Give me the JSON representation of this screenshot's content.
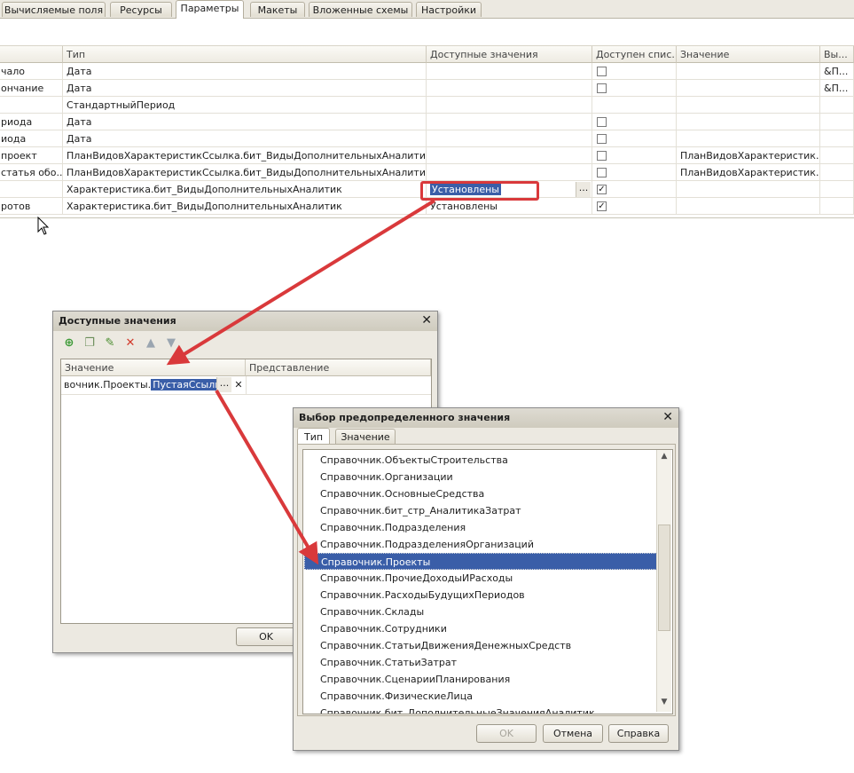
{
  "tabs": [
    {
      "label": "Вычисляемые поля",
      "active": false
    },
    {
      "label": "Ресурсы",
      "active": false
    },
    {
      "label": "Параметры",
      "active": true
    },
    {
      "label": "Макеты",
      "active": false
    },
    {
      "label": "Вложенные схемы",
      "active": false
    },
    {
      "label": "Настройки",
      "active": false
    }
  ],
  "grid": {
    "headers": [
      "",
      "Тип",
      "Доступные значения",
      "Доступен спис...",
      "Значение",
      "Вы..."
    ],
    "rows": [
      {
        "name": "чало",
        "type": "Дата",
        "avail": "",
        "check": "off",
        "value": "",
        "extra": "&П..."
      },
      {
        "name": "ончание",
        "type": "Дата",
        "avail": "",
        "check": "off",
        "value": "",
        "extra": "&П..."
      },
      {
        "name": "",
        "type": "СтандартныйПериод",
        "avail": "",
        "check": "none",
        "value": "",
        "extra": ""
      },
      {
        "name": "риода",
        "type": "Дата",
        "avail": "",
        "check": "off",
        "value": "",
        "extra": ""
      },
      {
        "name": "иода",
        "type": "Дата",
        "avail": "",
        "check": "off",
        "value": "",
        "extra": ""
      },
      {
        "name": "проект",
        "type": "ПланВидовХарактеристикСсылка.бит_ВидыДополнительныхАналитик",
        "avail": "",
        "check": "off",
        "value": "ПланВидовХарактеристик.б...",
        "extra": ""
      },
      {
        "name": "статья обо...",
        "type": "ПланВидовХарактеристикСсылка.бит_ВидыДополнительныхАналитик",
        "avail": "",
        "check": "off",
        "value": "ПланВидовХарактеристик.б...",
        "extra": ""
      },
      {
        "name": "",
        "type": "Характеристика.бит_ВидыДополнительныхАналитик",
        "avail": "Установлены",
        "check": "on",
        "value": "",
        "extra": "",
        "editing": true
      },
      {
        "name": "ротов",
        "type": "Характеристика.бит_ВидыДополнительныхАналитик",
        "avail": "Установлены",
        "check": "on",
        "value": "",
        "extra": ""
      }
    ]
  },
  "dialog1": {
    "title": "Доступные значения",
    "close": "✕",
    "col_value": "Значение",
    "col_repr": "Представление",
    "row_prefix": "вочник.Проекты.",
    "row_selected": "ПустаяСсылка",
    "dots": "...",
    "clear": "✕",
    "ok": "OK"
  },
  "dialog2": {
    "title": "Выбор предопределенного значения",
    "close": "✕",
    "tab_type": "Тип",
    "tab_value": "Значение",
    "items": [
      "Справочник.ОбъектыСтроительства",
      "Справочник.Организации",
      "Справочник.ОсновныеСредства",
      "Справочник.бит_стр_АналитикаЗатрат",
      "Справочник.Подразделения",
      "Справочник.ПодразделенияОрганизаций",
      "Справочник.Проекты",
      "Справочник.ПрочиеДоходыИРасходы",
      "Справочник.РасходыБудущихПериодов",
      "Справочник.Склады",
      "Справочник.Сотрудники",
      "Справочник.СтатьиДвиженияДенежныхСредств",
      "Справочник.СтатьиЗатрат",
      "Справочник.СценарииПланирования",
      "Справочник.ФизическиеЛица",
      "Справочник.бит_ДополнительныеЗначенияАналитик"
    ],
    "selected_index": 6,
    "ok": "OK",
    "cancel": "Отмена",
    "help": "Справка"
  },
  "colors": {
    "accent": "#3a5ea8",
    "arrow": "#d9393b",
    "highlight_box": "#d9393b"
  }
}
